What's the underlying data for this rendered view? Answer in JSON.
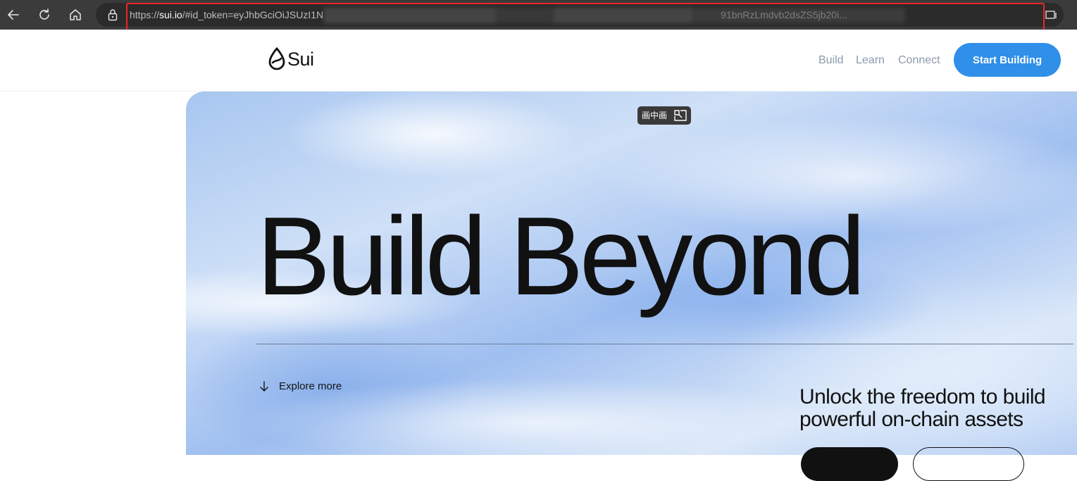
{
  "browser": {
    "url_scheme": "https://",
    "url_domain": "sui.io",
    "url_path": "/#id_token=eyJhbGciOiJSUzI1N                                                                                                                                                 91bnRzLmdvb2dsZS5jb20i...",
    "highlight_color": "#e8262b",
    "icons": [
      "back-icon",
      "reload-icon",
      "home-icon",
      "lock-icon",
      "reader-view-icon"
    ]
  },
  "site": {
    "logo_text": "Sui",
    "nav": [
      "Build",
      "Learn",
      "Connect"
    ],
    "cta_label": "Start Building",
    "accent_color": "#2f8fe9"
  },
  "overlay": {
    "pip_label": "画中画"
  },
  "hero": {
    "title": "Build Beyond",
    "explore_label": "Explore more",
    "tagline": "Unlock the freedom to build powerful on-chain assets"
  }
}
